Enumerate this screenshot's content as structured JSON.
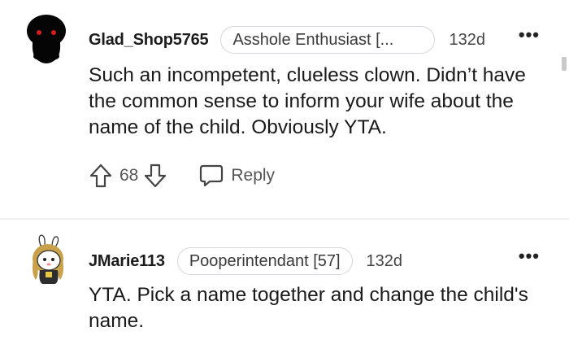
{
  "comments": [
    {
      "username": "Glad_Shop5765",
      "flair": "Asshole Enthusiast [...",
      "timestamp": "132d",
      "body": "Such an incompetent, clueless clown. Didn’t have the common sense to inform your wife about the name of the child. Obviously YTA.",
      "votes": "68",
      "reply_label": "Reply",
      "more_label": "•••",
      "avatar_icon": "snoo-dark-avatar-icon"
    },
    {
      "username": "JMarie113",
      "flair": "Pooperintendant [57]",
      "timestamp": "132d",
      "body": "YTA. Pick a name together and change the child's name.",
      "more_label": "•••",
      "avatar_icon": "snoo-bunny-avatar-icon"
    }
  ],
  "colors": {
    "text": "#1c1c1c",
    "muted": "#555555",
    "flair_border": "#d3d6da",
    "divider": "#edeff1"
  }
}
